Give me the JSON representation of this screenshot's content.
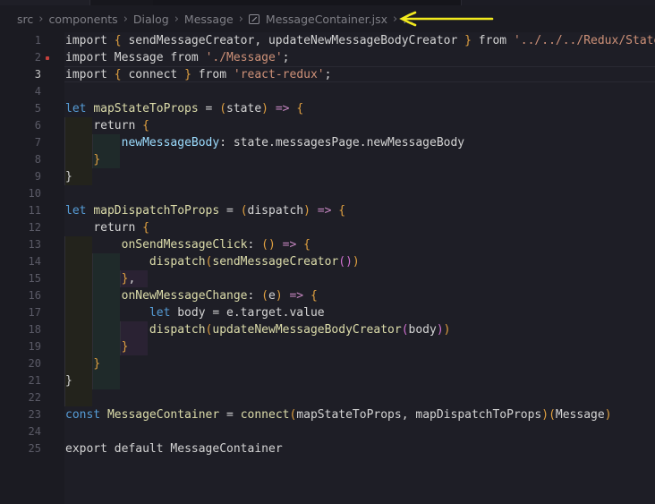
{
  "breadcrumb": {
    "items": [
      "src",
      "components",
      "Dialog",
      "Message"
    ],
    "file": "MessageContainer.jsx",
    "ellipsis": "..."
  },
  "colors": {
    "annotation_arrow": "#f2ea1e",
    "breakpoint": "#c5403c",
    "background": "#1e1e26"
  },
  "lines": [
    {
      "n": "1",
      "text": "import { sendMessageCreator, updateNewMessageBodyCreator } from '../../../Redux/State'"
    },
    {
      "n": "2",
      "text": "import Message from './Message';"
    },
    {
      "n": "3",
      "text": "import { connect } from 'react-redux';"
    },
    {
      "n": "4",
      "text": ""
    },
    {
      "n": "5",
      "text": "let mapStateToProps = (state) => {"
    },
    {
      "n": "6",
      "text": "    return {"
    },
    {
      "n": "7",
      "text": "        newMessageBody: state.messagesPage.newMessageBody"
    },
    {
      "n": "8",
      "text": "    }"
    },
    {
      "n": "9",
      "text": "}"
    },
    {
      "n": "10",
      "text": ""
    },
    {
      "n": "11",
      "text": "let mapDispatchToProps = (dispatch) => {"
    },
    {
      "n": "12",
      "text": "    return {"
    },
    {
      "n": "13",
      "text": "        onSendMessageClick: () => {"
    },
    {
      "n": "14",
      "text": "            dispatch(sendMessageCreator())"
    },
    {
      "n": "15",
      "text": "        },"
    },
    {
      "n": "16",
      "text": "        onNewMessageChange: (e) => {"
    },
    {
      "n": "17",
      "text": "            let body = e.target.value"
    },
    {
      "n": "18",
      "text": "            dispatch(updateNewMessageBodyCreator(body))"
    },
    {
      "n": "19",
      "text": "        }"
    },
    {
      "n": "20",
      "text": "    }"
    },
    {
      "n": "21",
      "text": "}"
    },
    {
      "n": "22",
      "text": ""
    },
    {
      "n": "23",
      "text": "const MessageContainer = connect(mapStateToProps, mapDispatchToProps)(Message)"
    },
    {
      "n": "24",
      "text": ""
    },
    {
      "n": "25",
      "text": "export default MessageContainer"
    }
  ]
}
